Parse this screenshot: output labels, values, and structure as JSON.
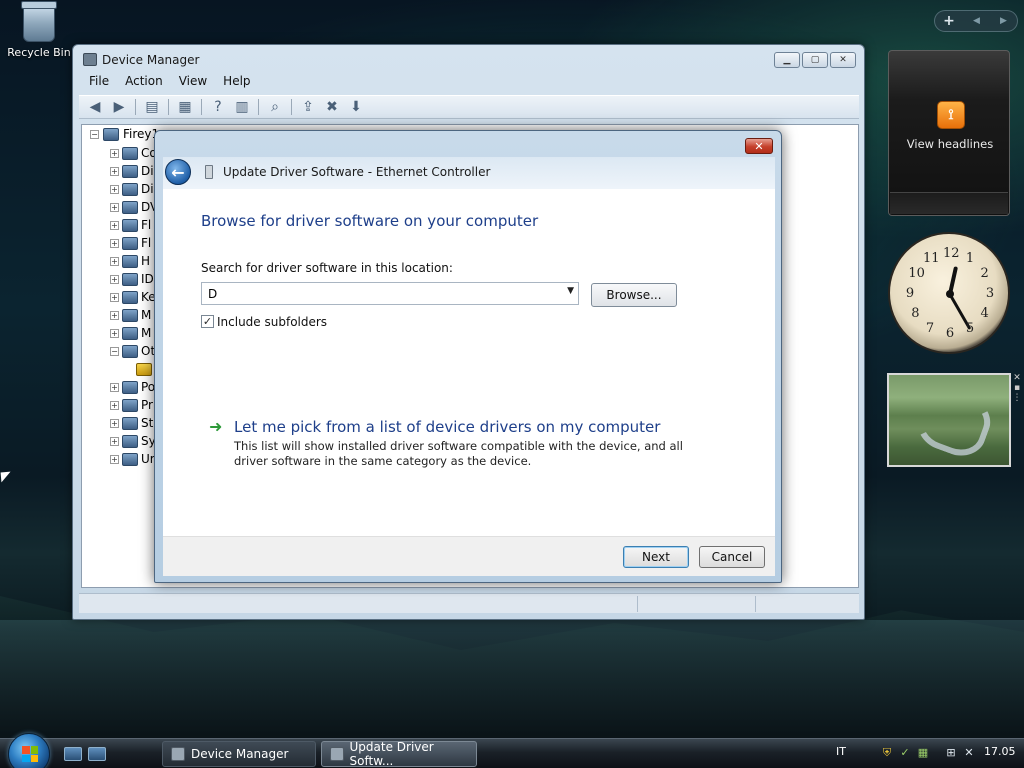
{
  "desktop": {
    "recycle_bin_label": "Recycle Bin"
  },
  "device_manager": {
    "title": "Device Manager",
    "menu": [
      "File",
      "Action",
      "View",
      "Help"
    ],
    "tree": {
      "root": "Firey1",
      "items": [
        {
          "label": "Co",
          "expander": "+"
        },
        {
          "label": "Di",
          "expander": "+"
        },
        {
          "label": "Di",
          "expander": "+"
        },
        {
          "label": "DV",
          "expander": "+"
        },
        {
          "label": "Fl",
          "expander": "+"
        },
        {
          "label": "Fl",
          "expander": "+"
        },
        {
          "label": "H",
          "expander": "+"
        },
        {
          "label": "ID",
          "expander": "+"
        },
        {
          "label": "Ke",
          "expander": "+"
        },
        {
          "label": "M",
          "expander": "+"
        },
        {
          "label": "M",
          "expander": "+"
        },
        {
          "label": "Ot",
          "expander": "−"
        },
        {
          "label": "",
          "expander": ""
        },
        {
          "label": "Po",
          "expander": "+"
        },
        {
          "label": "Pr",
          "expander": "+"
        },
        {
          "label": "St",
          "expander": "+"
        },
        {
          "label": "Sy",
          "expander": "+"
        },
        {
          "label": "Ur",
          "expander": "+"
        }
      ]
    }
  },
  "dialog": {
    "title": "Update Driver Software - Ethernet Controller",
    "close_label": "✕",
    "heading": "Browse for driver software on your computer",
    "search_label": "Search for driver software in this location:",
    "path_value": "D",
    "browse_label": "Browse...",
    "include_subfolders_label": "Include subfolders",
    "include_subfolders_checked": true,
    "pick_title": "Let me pick from a list of device drivers on my computer",
    "pick_description": "This list will show installed driver software compatible with the device, and all driver software in the same category as the device.",
    "next_label": "Next",
    "cancel_label": "Cancel"
  },
  "sidebar": {
    "add_label": "+",
    "feed_label": "View headlines",
    "clock": {
      "hour": 12,
      "minute": 25,
      "numbers": [
        "12",
        "1",
        "2",
        "3",
        "4",
        "5",
        "6",
        "7",
        "8",
        "9",
        "10",
        "11"
      ]
    }
  },
  "taskbar": {
    "buttons": [
      "Device Manager",
      "Update Driver Softw..."
    ],
    "language": "IT",
    "time": "17.05"
  }
}
